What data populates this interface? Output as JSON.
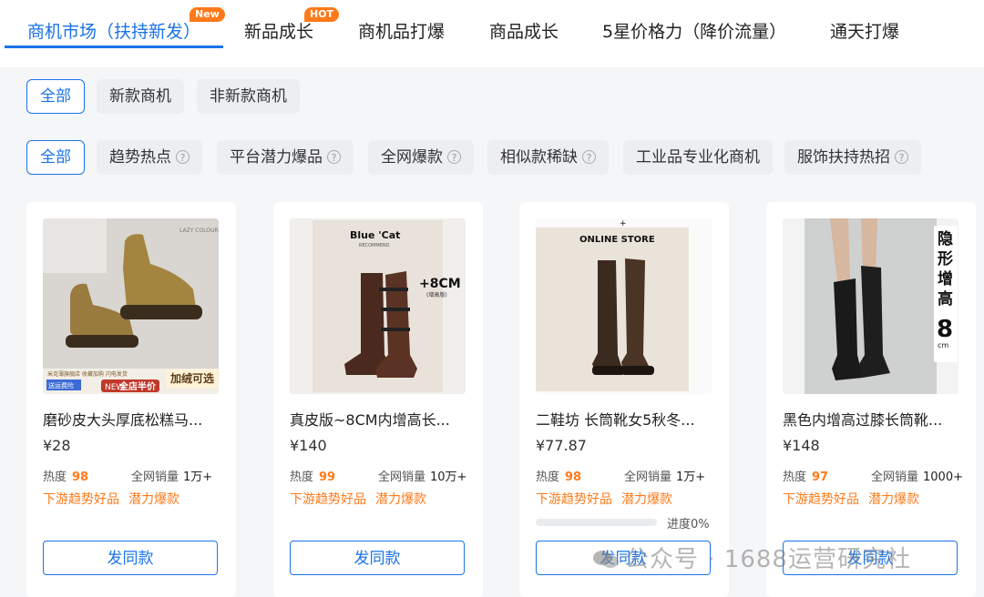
{
  "tabs": [
    {
      "label": "商机市场（扶持新发）",
      "badge": "New",
      "active": true
    },
    {
      "label": "新品成长",
      "badge": "HOT"
    },
    {
      "label": "商机品打爆"
    },
    {
      "label": "商品成长"
    },
    {
      "label": "5星价格力（降价流量）"
    },
    {
      "label": "通天打爆"
    }
  ],
  "filter_row1": [
    "全部",
    "新款商机",
    "非新款商机"
  ],
  "filter_row2": [
    {
      "label": "全部",
      "help": false
    },
    {
      "label": "趋势热点",
      "help": true
    },
    {
      "label": "平台潜力爆品",
      "help": true
    },
    {
      "label": "全网爆款",
      "help": true
    },
    {
      "label": "相似款稀缺",
      "help": true
    },
    {
      "label": "工业品专业化商机",
      "help": false
    },
    {
      "label": "服饰扶持热招",
      "help": true
    }
  ],
  "help_glyph": "?",
  "labels": {
    "heat": "热度",
    "sales": "全网销量",
    "tag1": "下游趋势好品",
    "tag2": "潜力爆款",
    "button": "发同款"
  },
  "products": [
    {
      "title": "磨砂皮大头厚底松糕马...",
      "price": "¥28",
      "heat": "98",
      "sales": "1万+",
      "image": {
        "top_right": "LAZY COLOUR",
        "badge_strip": "米克薄旗舰店  收藏加购  闪电发货",
        "promo": "加绒可选",
        "ship": "送运费险",
        "discount": "全店半价",
        "new_tag": "NEW"
      }
    },
    {
      "title": "真皮版~8CM内增高长...",
      "price": "¥140",
      "heat": "99",
      "sales": "10万+",
      "image": {
        "brand": "Blue 'Cat",
        "sub": "RECOMMEND",
        "height": "+8CM",
        "note": "(增高版)"
      }
    },
    {
      "title": "二鞋坊 长筒靴女5秋冬...",
      "price": "¥77.87",
      "heat": "98",
      "sales": "1万+",
      "progress": {
        "value": 0,
        "label": "进度0%"
      },
      "image": {
        "store": "ONLINE STORE",
        "plus": "+"
      }
    },
    {
      "title": "黑色内增高过膝长筒靴...",
      "price": "¥148",
      "heat": "97",
      "sales": "1000+",
      "image": {
        "slogan": "隐形增高",
        "height": "8",
        "unit": "cm"
      }
    }
  ],
  "watermark": "公众号 · 1688运营研究社",
  "colors": {
    "accent": "#1a73e8",
    "orange": "#ff7a1a"
  }
}
